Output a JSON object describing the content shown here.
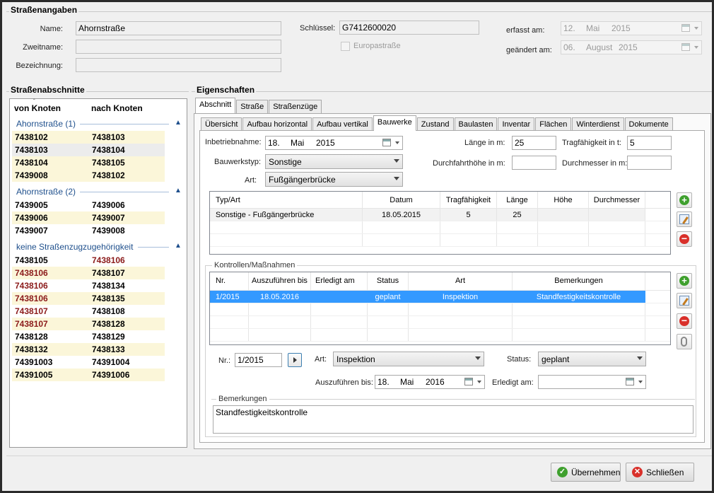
{
  "sections": {
    "street_info": "Straßenangaben",
    "segments": "Straßenabschnitte",
    "properties": "Eigenschaften"
  },
  "street": {
    "name_label": "Name:",
    "name_value": "Ahornstraße",
    "second_name_label": "Zweitname:",
    "second_name_value": "",
    "description_label": "Bezeichnung:",
    "description_value": "",
    "key_label": "Schlüssel:",
    "key_value": "G7412600020",
    "europastrasse_label": "Europastraße",
    "created_label": "erfasst am:",
    "created_day": "12.",
    "created_month": "Mai",
    "created_year": "2015",
    "changed_label": "geändert am:",
    "changed_day": "06.",
    "changed_month": "August",
    "changed_year": "2015"
  },
  "segment_list": {
    "col_from": "von Knoten",
    "col_to": "nach Knoten",
    "groups": [
      {
        "title": "Ahornstraße (1)",
        "rows": [
          [
            "7438102",
            "7438103"
          ],
          [
            "7438103",
            "7438104"
          ],
          [
            "7438104",
            "7438105"
          ],
          [
            "7439008",
            "7438102"
          ]
        ]
      },
      {
        "title": "Ahornstraße (2)",
        "rows": [
          [
            "7439005",
            "7439006"
          ],
          [
            "7439006",
            "7439007"
          ],
          [
            "7439007",
            "7439008"
          ]
        ]
      },
      {
        "title": "keine Straßenzugzugehörigkeit",
        "rows": [
          [
            "7438105",
            "7438106"
          ],
          [
            "7438106",
            "7438107"
          ],
          [
            "7438106",
            "7438134"
          ],
          [
            "7438106",
            "7438135"
          ],
          [
            "7438107",
            "7438108"
          ],
          [
            "7438107",
            "7438128"
          ],
          [
            "7438128",
            "7438129"
          ],
          [
            "7438132",
            "7438133"
          ],
          [
            "74391003",
            "74391004"
          ],
          [
            "74391005",
            "74391006"
          ]
        ]
      }
    ]
  },
  "outer_tabs": [
    "Abschnitt",
    "Straße",
    "Straßenzüge"
  ],
  "inner_tabs": [
    "Übersicht",
    "Aufbau horizontal",
    "Aufbau vertikal",
    "Bauwerke",
    "Zustand",
    "Baulasten",
    "Inventar",
    "Flächen",
    "Winterdienst",
    "Dokumente"
  ],
  "form": {
    "commissioning_label": "Inbetriebnahme:",
    "commissioning_day": "18.",
    "commissioning_month": "Mai",
    "commissioning_year": "2015",
    "type_label": "Bauwerkstyp:",
    "type_value": "Sonstige",
    "kind_label": "Art:",
    "kind_value": "Fußgängerbrücke",
    "length_label": "Länge in m:",
    "length_value": "25",
    "capacity_label": "Tragfähigkeit in t:",
    "capacity_value": "5",
    "clearance_label": "Durchfahrthöhe in m:",
    "clearance_value": "",
    "diameter_label": "Durchmesser in m:",
    "diameter_value": ""
  },
  "structures_table": {
    "headers": [
      "Typ/Art",
      "Datum",
      "Tragfähigkeit",
      "Länge",
      "Höhe",
      "Durchmesser"
    ],
    "rows": [
      [
        "Sonstige - Fußgängerbrücke",
        "18.05.2015",
        "5",
        "25",
        "",
        ""
      ]
    ]
  },
  "controls": {
    "title": "Kontrollen/Maßnahmen",
    "headers": [
      "Nr.",
      "Auszuführen bis",
      "Erledigt am",
      "Status",
      "Art",
      "Bemerkungen"
    ],
    "rows": [
      [
        "1/2015",
        "18.05.2016",
        "",
        "geplant",
        "Inspektion",
        "Standfestigkeitskontrolle"
      ]
    ]
  },
  "detail": {
    "nr_label": "Nr.:",
    "nr_value": "1/2015",
    "kind_label": "Art:",
    "kind_value": "Inspektion",
    "status_label": "Status:",
    "status_value": "geplant",
    "due_label": "Auszuführen bis:",
    "due_day": "18.",
    "due_month": "Mai",
    "due_year": "2016",
    "done_label": "Erledigt am:",
    "remarks_title": "Bemerkungen",
    "remarks_value": "Standfestigkeitskontrolle"
  },
  "buttons": {
    "apply": "Übernehmen",
    "close": "Schließen"
  },
  "colors": {
    "selection": "#3399ff",
    "section_blue": "#1e4f8c",
    "row_yellow": "#fbf6d9"
  }
}
